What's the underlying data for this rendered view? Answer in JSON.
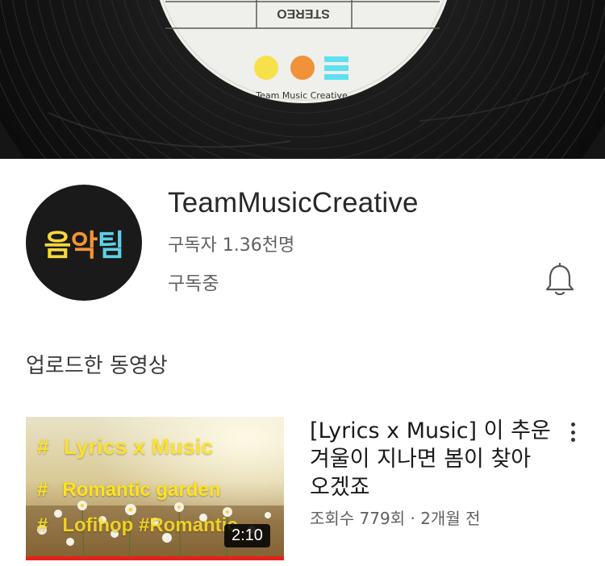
{
  "banner": {
    "label_brand": "Team Music Creative",
    "label_stereo": "STEREO",
    "dot_colors": [
      "#f7e14b",
      "#f0923a",
      "#5ee0f0"
    ]
  },
  "channel": {
    "avatar_chars": [
      "음",
      "악",
      "팀"
    ],
    "name": "TeamMusicCreative",
    "subscribers": "구독자 1.36천명",
    "subscribed_label": "구독중"
  },
  "section": {
    "title": "업로드한 동영상"
  },
  "videos": [
    {
      "thumb_lines": [
        {
          "hash": "#",
          "text": "Lyrics x Music"
        },
        {
          "hash": "#",
          "text": "Romantic garden"
        },
        {
          "hash": "#",
          "text": "Lofihop #Romantic"
        }
      ],
      "duration": "2:10",
      "title": "[Lyrics x Music] 이 추운 겨울이 지나면 봄이 찾아 오겠죠",
      "meta": "조회수 779회 · 2개월 전"
    }
  ],
  "icons": {
    "bell": "bell-icon",
    "more": "more-vert-icon"
  }
}
